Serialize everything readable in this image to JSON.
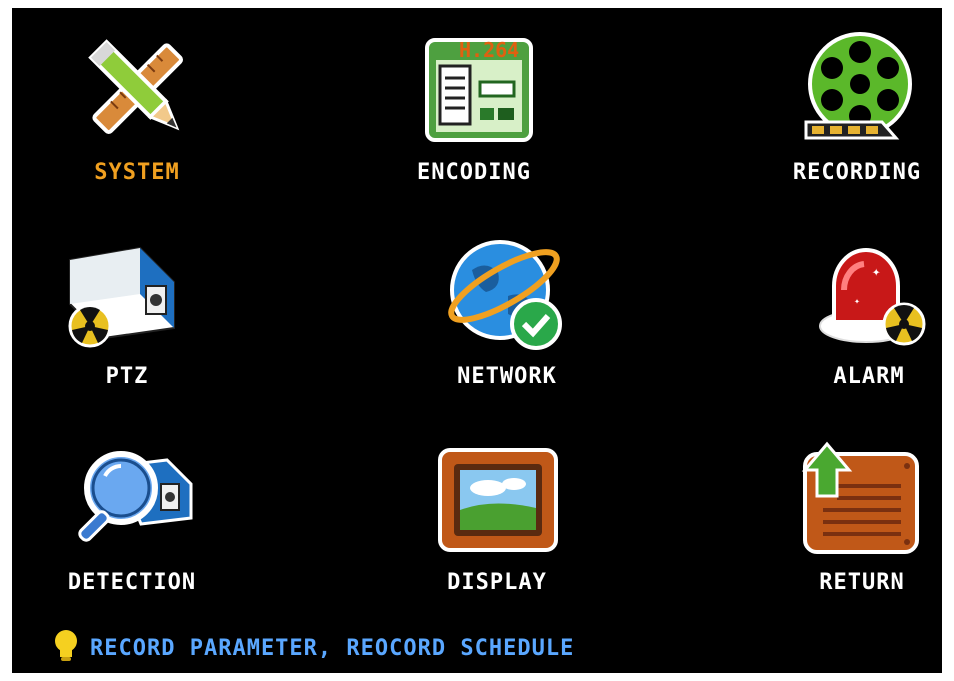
{
  "menu": {
    "items": [
      {
        "label": "SYSTEM",
        "icon": "pencil-ruler-icon",
        "selected": true
      },
      {
        "label": "ENCODING",
        "icon": "encoding-icon",
        "badge": "H.264"
      },
      {
        "label": "RECORDING",
        "icon": "film-reel-icon"
      },
      {
        "label": "PTZ",
        "icon": "ptz-camera-icon"
      },
      {
        "label": "NETWORK",
        "icon": "globe-check-icon"
      },
      {
        "label": "ALARM",
        "icon": "siren-icon"
      },
      {
        "label": "DETECTION",
        "icon": "magnifier-camera-icon"
      },
      {
        "label": "DISPLAY",
        "icon": "monitor-icon"
      },
      {
        "label": "RETURN",
        "icon": "return-icon"
      }
    ]
  },
  "status": {
    "text": "RECORD PARAMETER, REOCORD SCHEDULE",
    "icon": "lightbulb-icon"
  },
  "colors": {
    "background": "#000000",
    "label": "#ffffff",
    "selected_label": "#f0a020",
    "status_text": "#5aa7ff"
  }
}
